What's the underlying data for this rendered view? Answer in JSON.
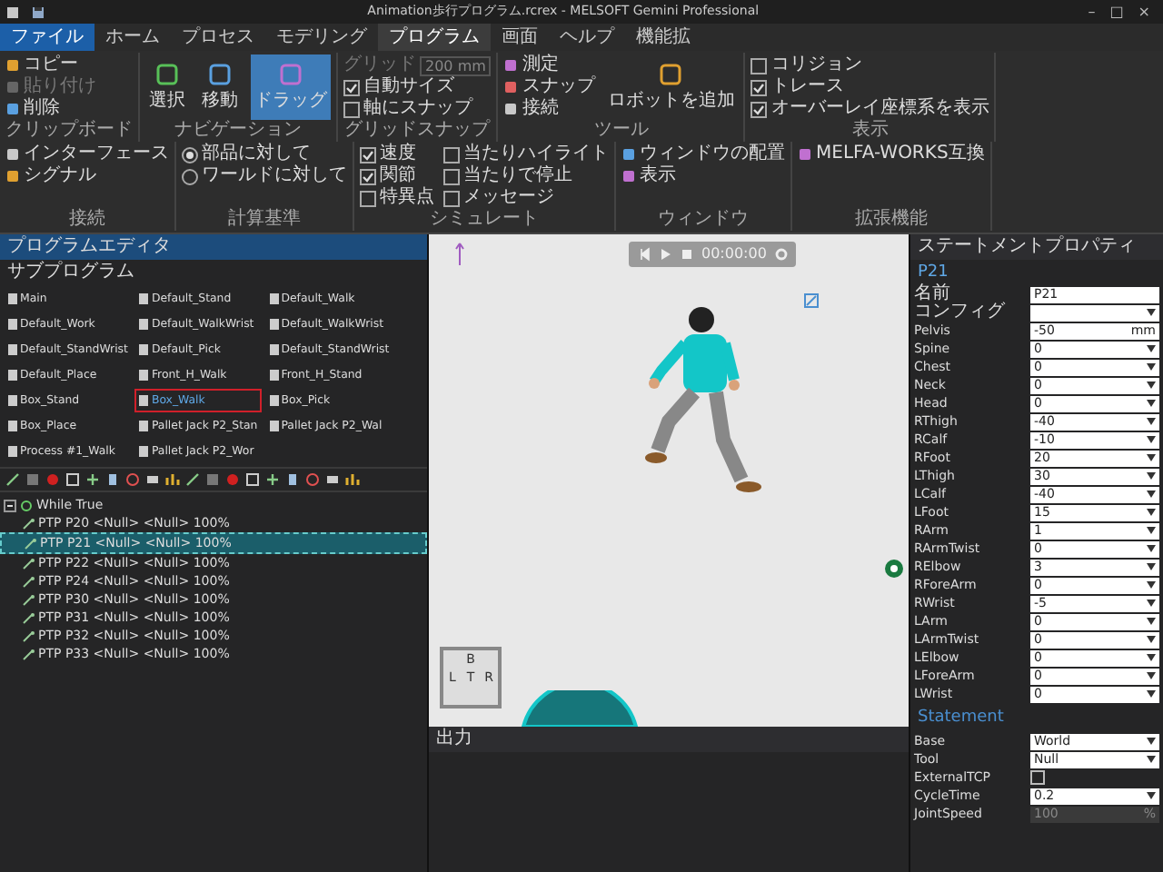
{
  "window": {
    "title": "Animation歩行プログラム.rcrex - MELSOFT Gemini Professional",
    "controls": [
      "–",
      "□",
      "×"
    ]
  },
  "menu": [
    {
      "label": "ファイル",
      "kind": "file",
      "selected": false
    },
    {
      "label": "ホーム",
      "kind": "tab",
      "selected": false
    },
    {
      "label": "プロセス",
      "kind": "tab",
      "selected": false
    },
    {
      "label": "モデリング",
      "kind": "tab",
      "selected": false
    },
    {
      "label": "プログラム",
      "kind": "tab",
      "selected": true
    },
    {
      "label": "画面",
      "kind": "tab",
      "selected": false
    },
    {
      "label": "ヘルプ",
      "kind": "tab",
      "selected": false
    },
    {
      "label": "機能拡",
      "kind": "tab",
      "selected": false
    }
  ],
  "ribbon": [
    {
      "label": "クリップボード",
      "items": [
        {
          "kind": "small",
          "label": "コピー",
          "disabled": false
        },
        {
          "kind": "small",
          "label": "貼り付け",
          "disabled": true
        },
        {
          "kind": "small",
          "label": "削除",
          "disabled": false
        }
      ]
    },
    {
      "label": "ナビゲーション",
      "items": [
        {
          "kind": "big",
          "label": "選択",
          "selected": false
        },
        {
          "kind": "big",
          "label": "移動",
          "selected": false
        },
        {
          "kind": "big",
          "label": "ドラッグ",
          "selected": true
        }
      ]
    },
    {
      "label": "グリッドスナップ",
      "items": [
        {
          "kind": "field",
          "label": "グリッド",
          "value": "200",
          "unit": "mm",
          "disabled": true
        },
        {
          "kind": "check",
          "label": "自動サイズ",
          "checked": true
        },
        {
          "kind": "check",
          "label": "軸にスナップ",
          "checked": false
        }
      ]
    },
    {
      "label": "ツール",
      "items": [
        {
          "kind": "small",
          "label": "測定",
          "disabled": false
        },
        {
          "kind": "small",
          "label": "スナップ",
          "disabled": false
        },
        {
          "kind": "small",
          "label": "接続",
          "disabled": false
        },
        {
          "kind": "big",
          "label": "ロボットを追加",
          "selected": false
        }
      ]
    },
    {
      "label": "表示",
      "items": [
        {
          "kind": "check",
          "label": "コリジョン",
          "checked": false
        },
        {
          "kind": "check",
          "label": "トレース",
          "checked": true
        },
        {
          "kind": "check",
          "label": "オーバーレイ座標系を表示",
          "checked": true
        }
      ]
    },
    {
      "label": "接続",
      "items": [
        {
          "kind": "small",
          "label": "インターフェース",
          "disabled": false
        },
        {
          "kind": "small",
          "label": "シグナル",
          "disabled": false
        }
      ]
    },
    {
      "label": "計算基準",
      "items": [
        {
          "kind": "radio",
          "label": "部品に対して",
          "selected": true
        },
        {
          "kind": "radio",
          "label": "ワールドに対して",
          "selected": false
        }
      ]
    },
    {
      "label": "シミュレート",
      "items": [
        {
          "kind": "check",
          "label": "速度",
          "checked": true
        },
        {
          "kind": "check",
          "label": "関節",
          "checked": true
        },
        {
          "kind": "check",
          "label": "特異点",
          "checked": false
        },
        {
          "kind": "check",
          "label": "当たりハイライト",
          "checked": false
        },
        {
          "kind": "check",
          "label": "当たりで停止",
          "checked": false
        },
        {
          "kind": "check",
          "label": "メッセージ",
          "checked": false
        }
      ]
    },
    {
      "label": "ウィンドウ",
      "items": [
        {
          "kind": "small",
          "label": "ウィンドウの配置",
          "disabled": false
        },
        {
          "kind": "small",
          "label": "表示",
          "disabled": false
        }
      ]
    },
    {
      "label": "拡張機能",
      "items": [
        {
          "kind": "small",
          "label": "MELFA-WORKS互換",
          "disabled": false
        }
      ]
    }
  ],
  "program_editor": {
    "title": "プログラムエディタ",
    "subprograms_label": "サブプログラム",
    "subprograms": [
      {
        "name": "Main",
        "selected": false
      },
      {
        "name": "Default_Stand",
        "selected": false
      },
      {
        "name": "Default_Walk",
        "selected": false
      },
      {
        "name": "Default_Work",
        "selected": false
      },
      {
        "name": "Default_WalkWrist",
        "selected": false
      },
      {
        "name": "Default_WalkWrist",
        "selected": false
      },
      {
        "name": "Default_StandWrist",
        "selected": false
      },
      {
        "name": "Default_Pick",
        "selected": false
      },
      {
        "name": "Default_StandWrist",
        "selected": false
      },
      {
        "name": "Default_Place",
        "selected": false
      },
      {
        "name": "Front_H_Walk",
        "selected": false
      },
      {
        "name": "Front_H_Stand",
        "selected": false
      },
      {
        "name": "Box_Stand",
        "selected": false
      },
      {
        "name": "Box_Walk",
        "selected": true
      },
      {
        "name": "Box_Pick",
        "selected": false
      },
      {
        "name": "Box_Place",
        "selected": false
      },
      {
        "name": "Pallet Jack P2_Stan",
        "selected": false
      },
      {
        "name": "Pallet Jack P2_Wal",
        "selected": false
      },
      {
        "name": "Process #1_Walk",
        "selected": false
      },
      {
        "name": "Pallet Jack P2_Wor",
        "selected": false
      }
    ],
    "tree": {
      "label": "While True",
      "expanded": true,
      "children": [
        {
          "label": "PTP P20 <Null> <Null> 100%",
          "selected": false
        },
        {
          "label": "PTP P21 <Null> <Null> 100%",
          "selected": true
        },
        {
          "label": "PTP P22 <Null> <Null> 100%",
          "selected": false
        },
        {
          "label": "PTP P24 <Null> <Null> 100%",
          "selected": false
        },
        {
          "label": "PTP P30 <Null> <Null> 100%",
          "selected": false
        },
        {
          "label": "PTP P31 <Null> <Null> 100%",
          "selected": false
        },
        {
          "label": "PTP P32 <Null> <Null> 100%",
          "selected": false
        },
        {
          "label": "PTP P33 <Null> <Null> 100%",
          "selected": false
        }
      ]
    }
  },
  "viewport": {
    "time": "00:00:00",
    "cube_labels": [
      "B",
      "L",
      "T",
      "R"
    ]
  },
  "output": {
    "title": "出力"
  },
  "properties": {
    "title": "ステートメントプロパティ",
    "name": "P21",
    "rows": [
      {
        "label": "名前",
        "kind": "text",
        "value": "P21"
      },
      {
        "label": "コンフィグ",
        "kind": "dropdown"
      },
      {
        "label": "Pelvis",
        "kind": "text",
        "value": "-50",
        "unit": "mm"
      },
      {
        "label": "Spine",
        "kind": "dropdown",
        "value": "0"
      },
      {
        "label": "Chest",
        "kind": "dropdown",
        "value": "0"
      },
      {
        "label": "Neck",
        "kind": "dropdown",
        "value": "0"
      },
      {
        "label": "Head",
        "kind": "dropdown",
        "value": "0"
      },
      {
        "label": "RThigh",
        "kind": "dropdown",
        "value": "-40"
      },
      {
        "label": "RCalf",
        "kind": "dropdown",
        "value": "-10"
      },
      {
        "label": "RFoot",
        "kind": "dropdown",
        "value": "20"
      },
      {
        "label": "LThigh",
        "kind": "dropdown",
        "value": "30"
      },
      {
        "label": "LCalf",
        "kind": "dropdown",
        "value": "-40"
      },
      {
        "label": "LFoot",
        "kind": "dropdown",
        "value": "15"
      },
      {
        "label": "RArm",
        "kind": "dropdown",
        "value": "1"
      },
      {
        "label": "RArmTwist",
        "kind": "dropdown",
        "value": "0"
      },
      {
        "label": "RElbow",
        "kind": "dropdown",
        "value": "3"
      },
      {
        "label": "RForeArm",
        "kind": "dropdown",
        "value": "0"
      },
      {
        "label": "RWrist",
        "kind": "dropdown",
        "value": "-5"
      },
      {
        "label": "LArm",
        "kind": "dropdown",
        "value": "0"
      },
      {
        "label": "LArmTwist",
        "kind": "dropdown",
        "value": "0"
      },
      {
        "label": "LElbow",
        "kind": "dropdown",
        "value": "0"
      },
      {
        "label": "LForeArm",
        "kind": "dropdown",
        "value": "0"
      },
      {
        "label": "LWrist",
        "kind": "dropdown",
        "value": "0"
      }
    ],
    "section": "Statement",
    "statement_rows": [
      {
        "label": "Base",
        "kind": "dropdown",
        "value": "World"
      },
      {
        "label": "Tool",
        "kind": "dropdown",
        "value": "Null"
      },
      {
        "label": "ExternalTCP",
        "kind": "check",
        "checked": false
      },
      {
        "label": "CycleTime",
        "kind": "dropdown",
        "value": "0.2"
      },
      {
        "label": "JointSpeed",
        "kind": "text",
        "value": "100",
        "unit": "%",
        "disabled": true
      }
    ]
  }
}
